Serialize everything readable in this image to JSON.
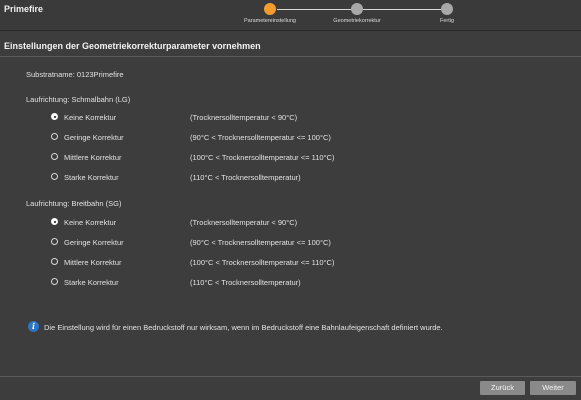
{
  "app": {
    "title": "Primefire"
  },
  "stepper": {
    "steps": [
      {
        "label": "Parametereinstellung",
        "state": "active"
      },
      {
        "label": "Geometriekorrektur",
        "state": "pending"
      },
      {
        "label": "Fertig",
        "state": "pending"
      }
    ],
    "active_color": "#f39c2b",
    "pending_color": "#a8a8a8"
  },
  "page": {
    "title": "Einstellungen der Geometriekorrekturparameter vornehmen"
  },
  "substrate": {
    "label": "Substratname: 0123Primefire"
  },
  "groups": [
    {
      "heading": "Laufrichtung: Schmalbahn (LG)",
      "options": [
        {
          "label": "Keine Korrektur",
          "desc": "(Trocknersolltemperatur < 90°C)",
          "checked": true
        },
        {
          "label": "Geringe Korrektur",
          "desc": "(90°C < Trocknersolltemperatur <= 100°C)",
          "checked": false
        },
        {
          "label": "Mittlere Korrektur",
          "desc": "(100°C < Trocknersolltemperatur <= 110°C)",
          "checked": false
        },
        {
          "label": "Starke Korrektur",
          "desc": "(110°C < Trocknersolltemperatur)",
          "checked": false
        }
      ]
    },
    {
      "heading": "Laufrichtung: Breitbahn (SG)",
      "options": [
        {
          "label": "Keine Korrektur",
          "desc": "(Trocknersolltemperatur < 90°C)",
          "checked": true
        },
        {
          "label": "Geringe Korrektur",
          "desc": "(90°C < Trocknersolltemperatur <= 100°C)",
          "checked": false
        },
        {
          "label": "Mittlere Korrektur",
          "desc": "(100°C < Trocknersolltemperatur <= 110°C)",
          "checked": false
        },
        {
          "label": "Starke Korrektur",
          "desc": "(110°C < Trocknersolltemperatur)",
          "checked": false
        }
      ]
    }
  ],
  "info": {
    "icon": "info-icon",
    "text": "Die Einstellung wird für einen Bedruckstoff nur wirksam, wenn im Bedruckstoff eine Bahnlaufeigenschaft definiert wurde."
  },
  "footer": {
    "back_label": "Zurück",
    "next_label": "Weiter"
  }
}
